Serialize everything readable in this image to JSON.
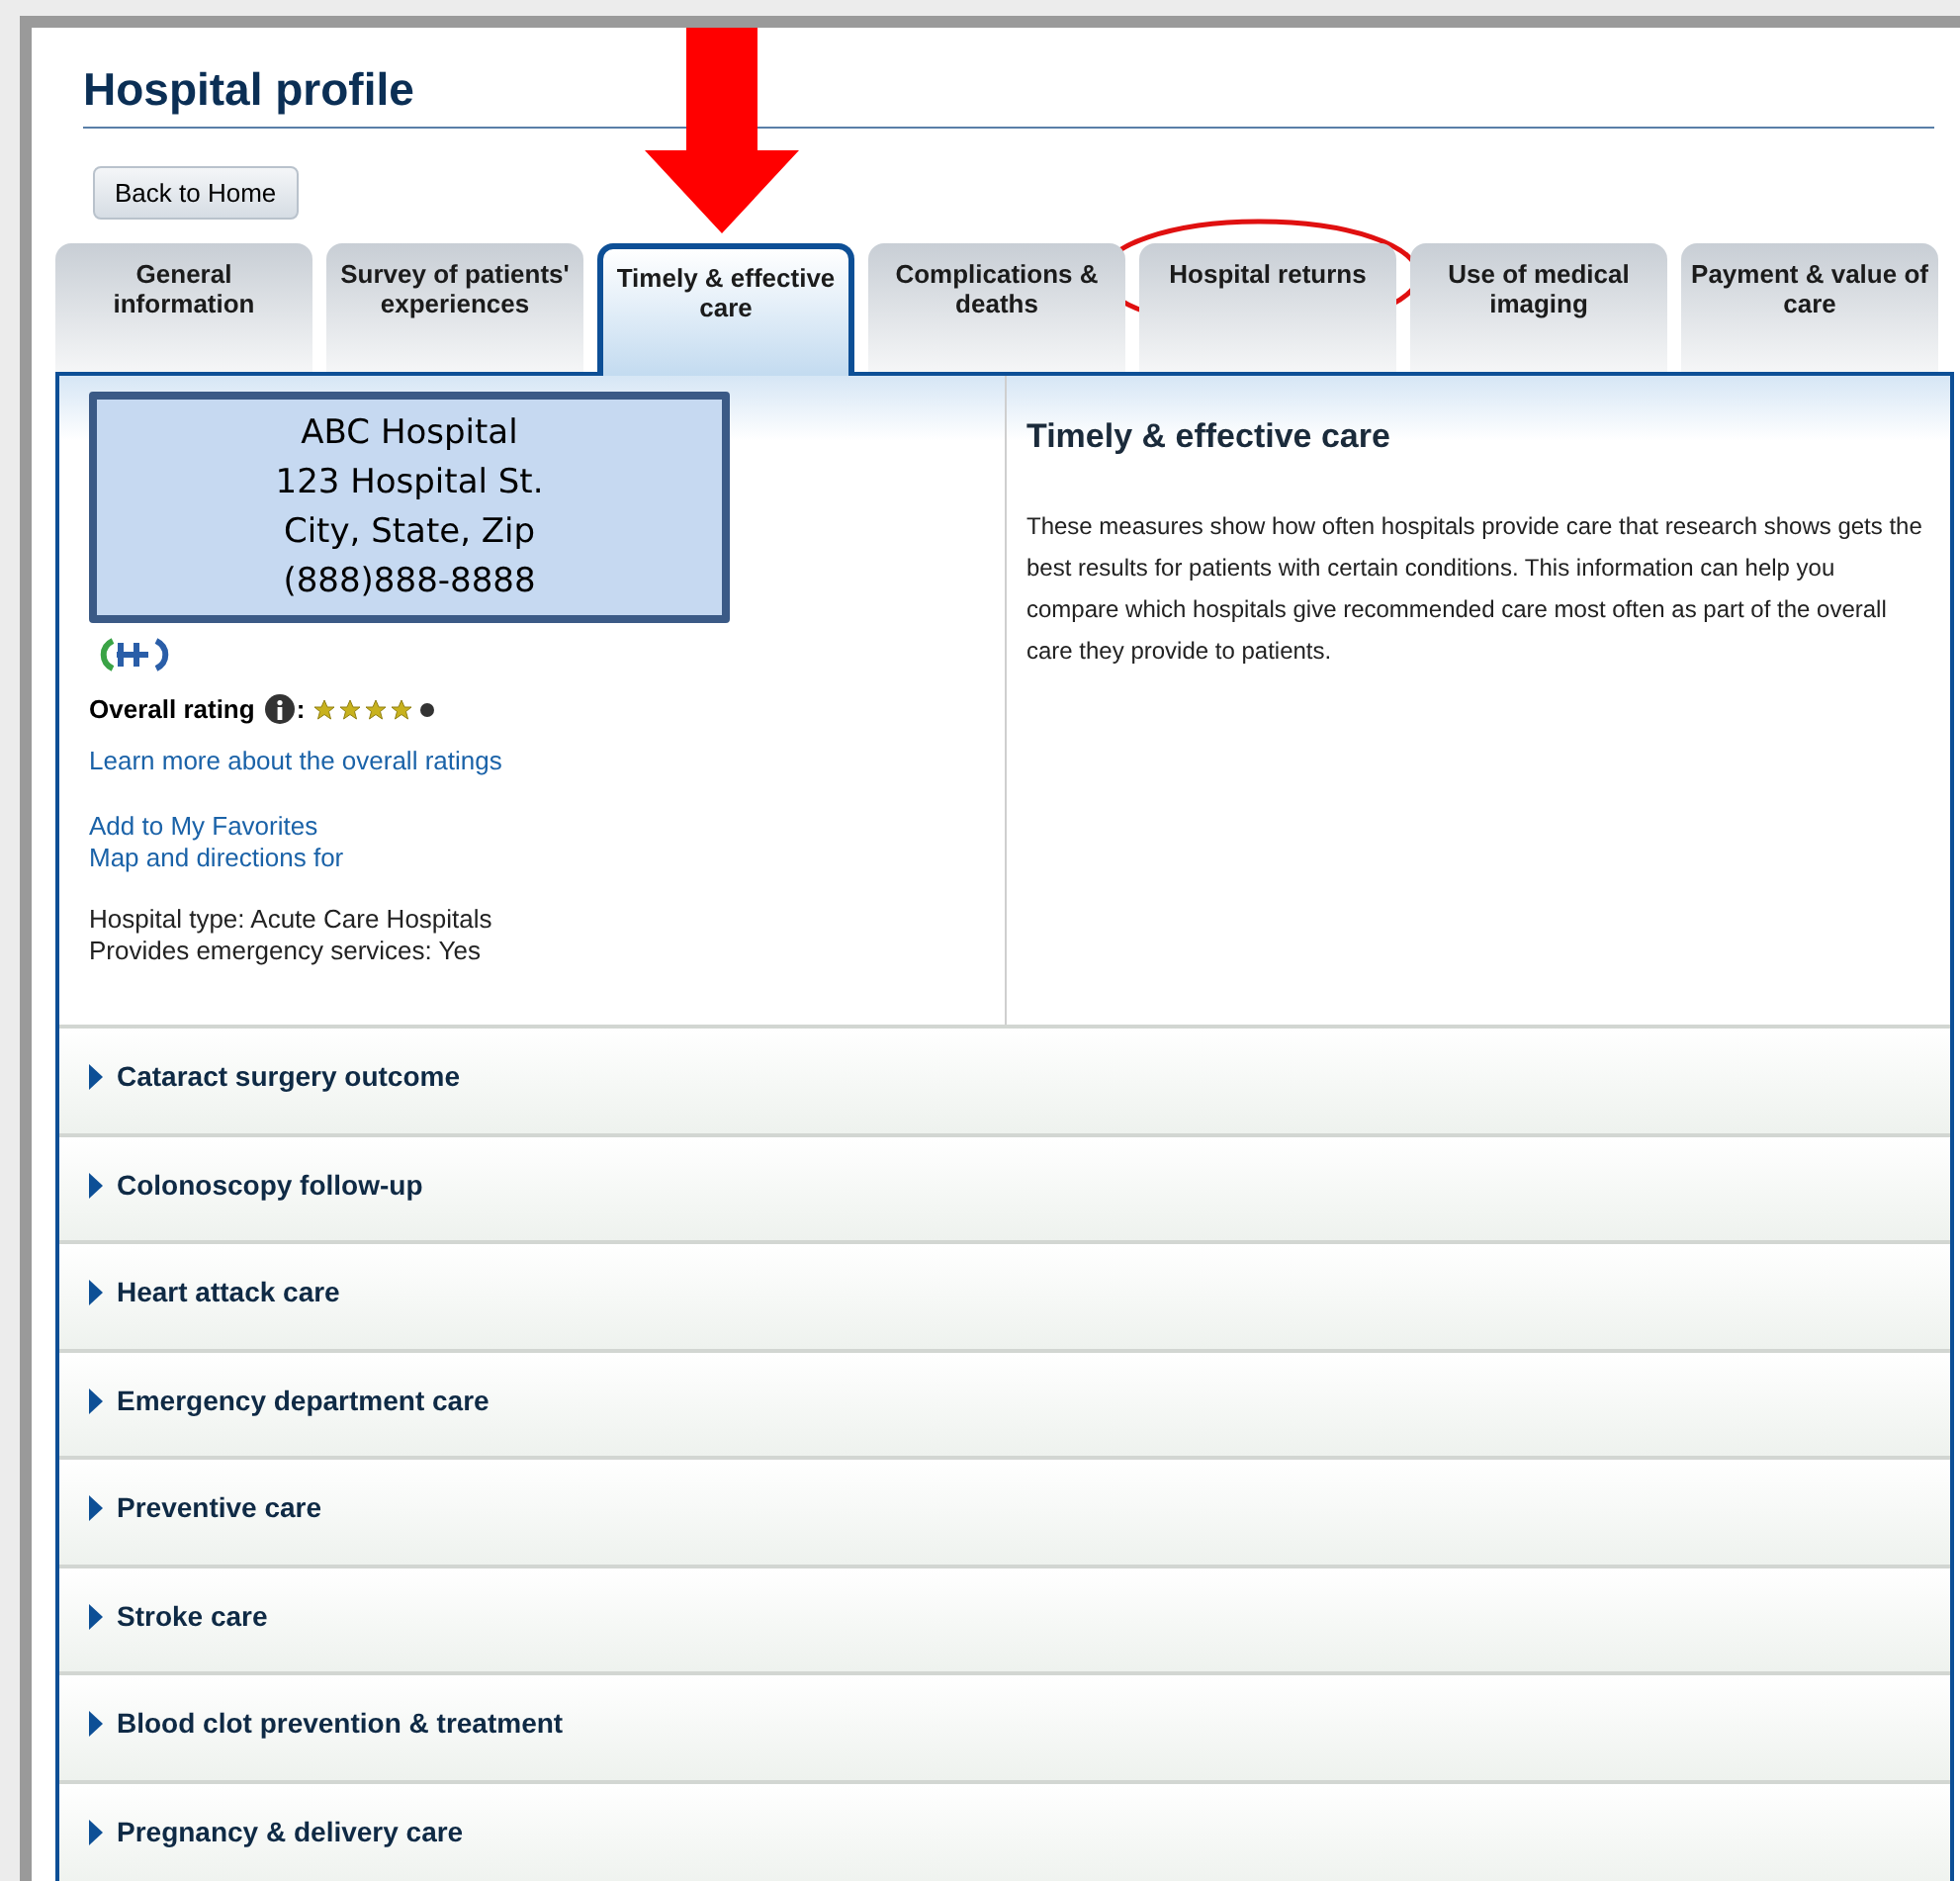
{
  "page": {
    "title": "Hospital profile"
  },
  "back_button": {
    "label": "Back to Home"
  },
  "tabs": [
    {
      "label": "General information",
      "selected": false
    },
    {
      "label": "Survey of patients' experiences",
      "selected": false
    },
    {
      "label": "Timely & effective care",
      "selected": true
    },
    {
      "label": "Complications & deaths",
      "selected": false
    },
    {
      "label": "Hospital returns",
      "selected": false
    },
    {
      "label": "Use of medical imaging",
      "selected": false
    },
    {
      "label": "Payment & value of care",
      "selected": false
    }
  ],
  "hospital": {
    "address_lines": [
      "ABC Hospital",
      "123 Hospital St.",
      "City, State, Zip",
      "(888)888-8888"
    ],
    "rating_label": "Overall rating",
    "rating_colon": ":",
    "stars": 4,
    "ratings_link": "Learn more about the overall ratings",
    "links": [
      "Add to My Favorites",
      "Map and directions for"
    ],
    "details": [
      "Hospital type: Acute Care Hospitals",
      "Provides emergency services: Yes"
    ]
  },
  "section": {
    "title": "Timely & effective care",
    "body": "These measures show how often hospitals provide care that research shows gets the best results for patients with certain conditions. This information can help you compare which hospitals give recommended care most often as part of the overall care they provide to patients."
  },
  "accordion": [
    {
      "label": "Cataract surgery outcome",
      "expanded": false
    },
    {
      "label": "Colonoscopy follow-up",
      "expanded": false
    },
    {
      "label": "Heart attack care",
      "expanded": false
    },
    {
      "label": "Emergency department care",
      "expanded": false
    },
    {
      "label": "Preventive care",
      "expanded": false
    },
    {
      "label": "Stroke care",
      "expanded": false
    },
    {
      "label": "Blood clot prevention & treatment",
      "expanded": false
    },
    {
      "label": "Pregnancy & delivery care",
      "expanded": false
    }
  ]
}
